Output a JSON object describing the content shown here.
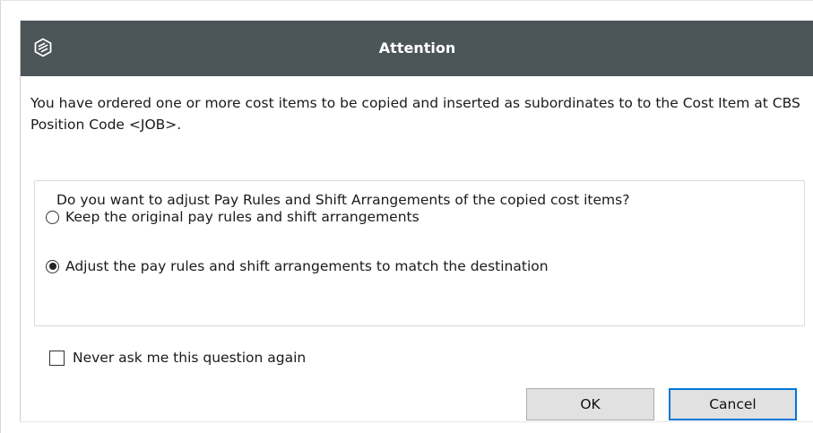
{
  "dialog": {
    "title": "Attention",
    "icon": "app-logo-icon",
    "message": "You have ordered one or more cost items to be copied and inserted as subordinates to to the Cost Item at CBS Position Code <JOB>.",
    "group": {
      "legend": "Do you want to adjust Pay Rules and Shift Arrangements of the copied cost items?",
      "options": [
        {
          "label": "Keep the original pay rules and shift arrangements",
          "selected": false
        },
        {
          "label": "Adjust the pay rules and shift arrangements to match the destination",
          "selected": true
        }
      ]
    },
    "never_ask": {
      "label": "Never ask me this question again",
      "checked": false
    },
    "buttons": {
      "ok": "OK",
      "cancel": "Cancel"
    },
    "colors": {
      "titlebar": "#4c5558",
      "focus_border": "#0078d7",
      "button_face": "#e1e1e1"
    }
  }
}
